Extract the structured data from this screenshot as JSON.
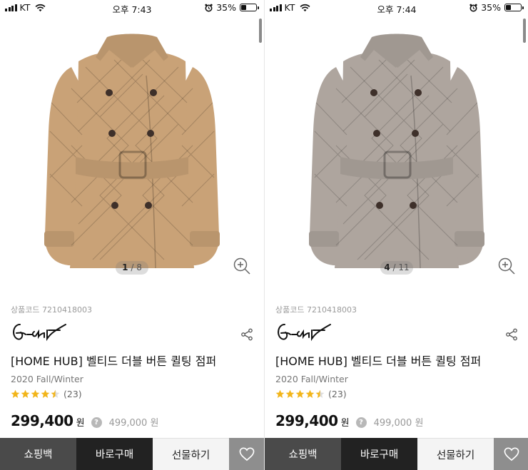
{
  "screens": [
    {
      "status": {
        "carrier": "KT",
        "time": "오후 7:43",
        "battery": "35%",
        "battery_level": 0.35
      },
      "gallery": {
        "current": "1",
        "total": "8"
      },
      "product": {
        "code": "상품코드 7210418003",
        "brand_logo": "G-cut",
        "title": "[HOME HUB] 벨티드 더블 버튼 퀼팅 점퍼",
        "season": "2020 Fall/Winter",
        "rating_value": 4.5,
        "review_count": "(23)",
        "price": "299,400",
        "price_unit": "원",
        "price_info_icon": "?",
        "original_price": "499,000 원"
      },
      "coat_color": "#c9a277"
    },
    {
      "status": {
        "carrier": "KT",
        "time": "오후 7:44",
        "battery": "35%",
        "battery_level": 0.35
      },
      "gallery": {
        "current": "4",
        "total": "11"
      },
      "product": {
        "code": "상품코드 7210418003",
        "brand_logo": "G-cut",
        "title": "[HOME HUB] 벨티드 더블 버튼 퀼팅 점퍼",
        "season": "2020 Fall/Winter",
        "rating_value": 4.5,
        "review_count": "(23)",
        "price": "299,400",
        "price_unit": "원",
        "price_info_icon": "?",
        "original_price": "499,000 원"
      },
      "coat_color": "#aea59e"
    }
  ],
  "bottom_bar": {
    "cart_label": "쇼핑백",
    "buy_label": "바로구매",
    "gift_label": "선물하기",
    "wishlist_icon": "heart-icon"
  },
  "colors": {
    "star": "#f2b51a",
    "dark": "#222222",
    "cart_bg": "#4a4a4a",
    "wish_bg": "#8e8e8e"
  }
}
